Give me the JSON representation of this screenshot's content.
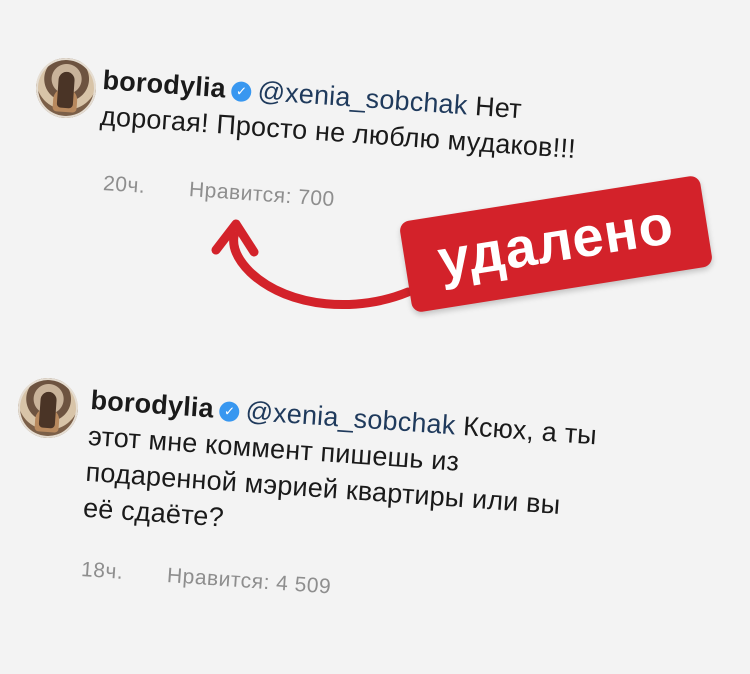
{
  "comments": [
    {
      "username": "borodylia",
      "mention": "@xenia_sobchak",
      "text_line1": "Нет",
      "text_line2": "дорогая! Просто не люблю мудаков!!!",
      "time": "20ч.",
      "likes": "Нравится: 700"
    },
    {
      "username": "borodylia",
      "mention": "@xenia_sobchak",
      "text_line1": "Ксюх, а ты",
      "text_line2": "этот мне коммент пишешь из",
      "text_line3": "подаренной мэрией квартиры или вы",
      "text_line4": "её сдаёте?",
      "time": "18ч.",
      "likes": "Нравится: 4 509"
    }
  ],
  "badge": {
    "label": "удалено",
    "color": "#d3222a"
  },
  "icons": {
    "verified": "verified-badge-icon",
    "arrow": "curved-arrow-icon"
  },
  "colors": {
    "background": "#f3f3f3",
    "verified_blue": "#3897f0",
    "meta_gray": "#8e8e8e"
  }
}
